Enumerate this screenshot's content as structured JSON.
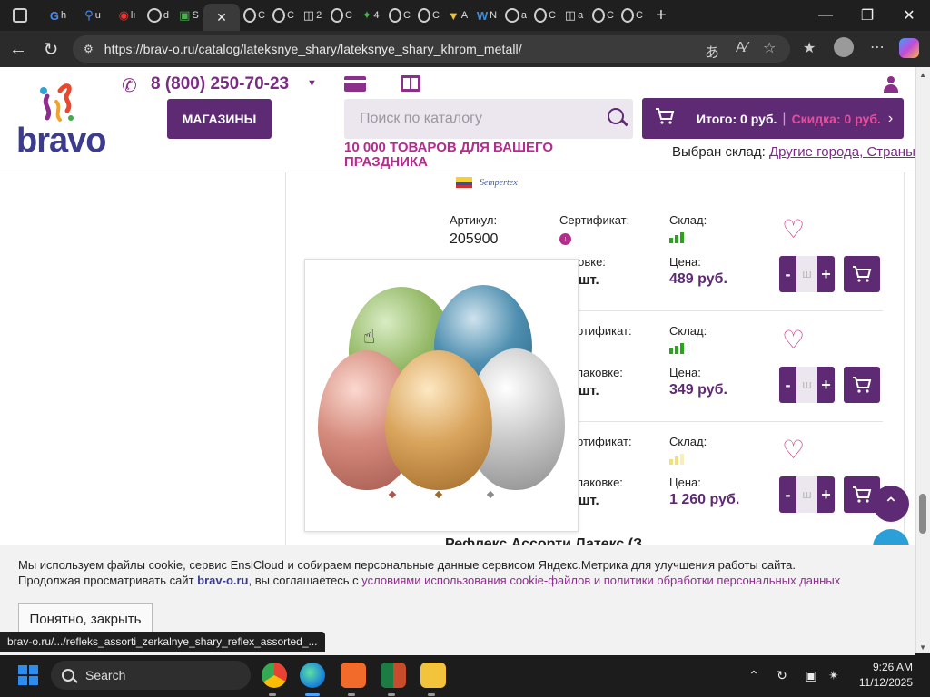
{
  "browser": {
    "url": "https://brav-o.ru/catalog/lateksnye_shary/lateksnye_shary_khrom_metall/",
    "status_link": "brav-o.ru/.../refleks_assorti_zerkalnye_shary_reflex_assorted_...",
    "tabs": [
      "h",
      "u",
      "lı",
      "d",
      "S",
      "C",
      "C",
      "2",
      "C",
      "4",
      "C",
      "C",
      "A",
      "N",
      "a",
      "C",
      "a",
      "C",
      "C"
    ]
  },
  "header": {
    "logo_text": "bravo",
    "phone": "8 (800) 250-70-23",
    "shops_label": "МАГАЗИНЫ",
    "search_placeholder": "Поиск по каталогу",
    "cart_total": "Итого: 0 руб.",
    "cart_separator": "|",
    "cart_discount": "Скидка: 0 руб.",
    "promo": "10 000 ТОВАРОВ ДЛЯ ВАШЕГО ПРАЗДНИКА",
    "warehouse_label": "Выбран склад:",
    "warehouse_value": "Другие города, Страны"
  },
  "brand": "Sempertex",
  "labels": {
    "article": "Артикул:",
    "certificate": "Сертификат:",
    "stock": "Склад:",
    "packaging": "Упаковке:",
    "price": "Цена:",
    "qty_minus": "-",
    "qty_plus": "+",
    "qty_placeholder": "ш"
  },
  "products": [
    {
      "article": "205900",
      "pack": "шт.",
      "price": "489 руб.",
      "stock_color": "#2aa31e"
    },
    {
      "article": "",
      "pack": "шт.",
      "price": "349 руб.",
      "stock_color": "#2aa31e"
    },
    {
      "article": "",
      "pack": "шт.",
      "price": "1 260 руб.",
      "stock_color": "#f1e07a"
    }
  ],
  "popup_cut_labels": [
    "Р",
    "шт.",
    "ртификат:",
    "паковке:",
    "шт.",
    "ртификат:",
    "паковке:",
    "шт."
  ],
  "cut_title": "Рефлекс Ассорти Латекс (З",
  "cookie": {
    "line1": "Мы используем файлы cookie, сервис EnsiCloud и собираем персональные данные сервисом Яндекс.Метрика для улучшения работы сайта.",
    "line2_prefix": "Продолжая просматривать сайт",
    "line2_brand": "brav-o.ru",
    "line2_mid": ", вы соглашаетесь с",
    "line2_link": "условиями использования cookie-файлов и политики обработки персональных данных",
    "button": "Понятно, закрыть"
  },
  "taskbar": {
    "search": "Search",
    "time": "9:26 AM",
    "date": "11/12/2025"
  },
  "colors": {
    "brand_purple": "#5e2a73",
    "accent_pink": "#b52c8c"
  }
}
